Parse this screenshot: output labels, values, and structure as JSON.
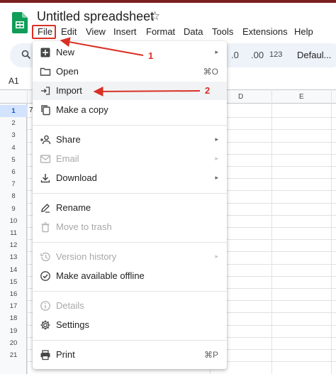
{
  "document": {
    "title": "Untitled spreadsheet",
    "star_icon": "star-outline-icon",
    "logo_icon": "sheets-logo-icon"
  },
  "menubar": {
    "items": [
      "File",
      "Edit",
      "View",
      "Insert",
      "Format",
      "Data",
      "Tools",
      "Extensions",
      "Help"
    ]
  },
  "toolbar": {
    "search_icon": "search-icon",
    "decrease_decimal": ".0",
    "increase_decimal": ".00",
    "number_format": "123",
    "font": "Defaul..."
  },
  "name_box": {
    "value": "A1"
  },
  "grid": {
    "column_headers": [
      "D",
      "E"
    ],
    "row_numbers": [
      "1",
      "2",
      "3",
      "4",
      "5",
      "6",
      "7",
      "8",
      "9",
      "10",
      "11",
      "12",
      "13",
      "14",
      "15",
      "16",
      "17",
      "18",
      "19",
      "20",
      "21"
    ],
    "selected_row": "1",
    "partial_cell_text": "7"
  },
  "file_menu": {
    "items": [
      {
        "label": "New",
        "icon": "new-plus-icon",
        "submenu": true
      },
      {
        "label": "Open",
        "icon": "folder-icon",
        "shortcut": "⌘O"
      },
      {
        "label": "Import",
        "icon": "import-icon",
        "highlighted": true
      },
      {
        "label": "Make a copy",
        "icon": "copy-icon"
      },
      {
        "label": "Share",
        "icon": "person-add-icon",
        "submenu": true
      },
      {
        "label": "Email",
        "icon": "email-icon",
        "submenu": true,
        "disabled": true
      },
      {
        "label": "Download",
        "icon": "download-icon",
        "submenu": true
      },
      {
        "label": "Rename",
        "icon": "rename-pencil-icon"
      },
      {
        "label": "Move to trash",
        "icon": "trash-icon",
        "disabled": true
      },
      {
        "label": "Version history",
        "icon": "history-icon",
        "submenu": true,
        "disabled": true
      },
      {
        "label": "Make available offline",
        "icon": "offline-check-icon"
      },
      {
        "label": "Details",
        "icon": "info-icon",
        "disabled": true
      },
      {
        "label": "Settings",
        "icon": "gear-icon"
      },
      {
        "label": "Print",
        "icon": "printer-icon",
        "shortcut": "⌘P"
      }
    ],
    "submenu_glyph": "▸"
  },
  "annotations": {
    "label_1": "1",
    "label_2": "2",
    "color": "#d93025"
  }
}
